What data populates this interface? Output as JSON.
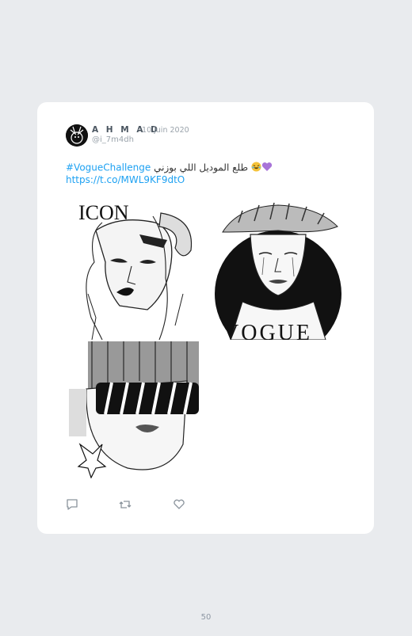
{
  "tweet": {
    "author_name": "A H M A D",
    "date": "· 10 juin 2020",
    "handle": "@i_7m4dh",
    "hashtag": "#VogueChallenge",
    "body_text": "طلع الموديل اللي بوزني",
    "link": "https://t.co/MWL9KF9dtO",
    "image_captions": [
      "ICON",
      "VOGUE"
    ],
    "actions": [
      {
        "name": "reply",
        "icon": "speech-bubble-icon"
      },
      {
        "name": "retweet",
        "icon": "retweet-icon"
      },
      {
        "name": "like",
        "icon": "heart-icon"
      }
    ]
  },
  "page": {
    "number": "50"
  },
  "colors": {
    "background": "#e9ebee",
    "card": "#ffffff",
    "link": "#1da1f2",
    "muted": "#9aa3ab"
  }
}
